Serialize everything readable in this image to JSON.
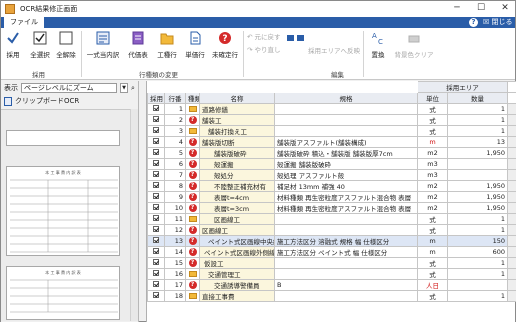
{
  "window": {
    "title": "OCR結果修正画面",
    "close_label": "✕",
    "close_panel_label": "閉じる"
  },
  "menu": {
    "file_tab": "ファイル",
    "help": "?"
  },
  "ribbon": {
    "adopt": "採用",
    "select_all": "全選択",
    "deselect_all": "全解除",
    "group_adopt": "採用",
    "batch_match": "一式当内訳",
    "replace": "代価表",
    "work_rows": "工種行",
    "unit_rows": "単価行",
    "unconfirmed": "未確定行",
    "group_row_kind": "行種類の変更",
    "undo": "元に戻す",
    "redo": "やり直し",
    "adopt_area_move": "採用エリアへ反映",
    "group_edit": "編集",
    "replace_text": "置換",
    "clear_bg": "背景色クリア"
  },
  "left": {
    "display_label": "表示",
    "zoom_value": "ページレベルにズーム",
    "clipboard_ocr": "クリップボードOCR",
    "page_title": "本 工 事 費 内 訳 表"
  },
  "grid": {
    "adopt_area_title": "採用エリア",
    "headers": [
      "採用",
      "行番",
      "種類",
      "名称",
      "規格",
      "単位",
      "数量"
    ],
    "rows": [
      {
        "no": "1",
        "kind": "folder",
        "name": "道路修繕",
        "spec": "",
        "unit": "式",
        "qty": "1"
      },
      {
        "no": "2",
        "kind": "q",
        "name": "舗装工",
        "spec": "",
        "unit": "式",
        "qty": "1"
      },
      {
        "no": "3",
        "kind": "folder",
        "name": "舗装打換え工",
        "spec": "",
        "unit": "式",
        "qty": "1"
      },
      {
        "no": "4",
        "kind": "q",
        "name": "舗装版切断",
        "spec": "舗装版アスファルト(舗装構成)",
        "unit": "m",
        "qty": "13",
        "unit_red": true
      },
      {
        "no": "5",
        "kind": "q",
        "name": "舗装版破砕",
        "spec": "舗装版破砕 積込・舗装版 舗装版厚7cm",
        "unit": "m2",
        "qty": "1,950"
      },
      {
        "no": "6",
        "kind": "q",
        "name": "殻運搬",
        "spec": "殻運搬 舗装版破砕",
        "unit": "m3",
        "qty": ""
      },
      {
        "no": "7",
        "kind": "q",
        "name": "殻処分",
        "spec": "殻処理 アスファルト殻",
        "unit": "m3",
        "qty": ""
      },
      {
        "no": "8",
        "kind": "q",
        "name": "不陸整正補充材有",
        "spec": "補足材 13mm 補強 40",
        "unit": "m2",
        "qty": "1,950"
      },
      {
        "no": "9",
        "kind": "q",
        "name": "表層t=4cm",
        "spec": "材料種類 再生密粒度アスファルト混合物 表層",
        "unit": "m2",
        "qty": "1,950"
      },
      {
        "no": "10",
        "kind": "q",
        "name": "表層t=3cm",
        "spec": "材料種類 再生密粒度アスファルト混合物 表層",
        "unit": "m2",
        "qty": "1,950"
      },
      {
        "no": "11",
        "kind": "folder",
        "name": "区画線工",
        "spec": "",
        "unit": "式",
        "qty": "1"
      },
      {
        "no": "12",
        "kind": "q",
        "name": "区画線工",
        "spec": "",
        "unit": "式",
        "qty": "1"
      },
      {
        "no": "13",
        "kind": "q",
        "name": "ペイント式区画線中央線",
        "spec": "施工方法区分 溶融式 規格 幅 仕様区分",
        "unit": "m",
        "qty": "150",
        "sel": true
      },
      {
        "no": "14",
        "kind": "q",
        "name": "ペイント式区画線外側線",
        "spec": "施工方法区分 ペイント式 幅 仕様区分",
        "unit": "m",
        "qty": "600"
      },
      {
        "no": "15",
        "kind": "q",
        "name": "仮設工",
        "spec": "",
        "unit": "式",
        "qty": "1"
      },
      {
        "no": "16",
        "kind": "folder",
        "name": "交通管理工",
        "spec": "",
        "unit": "式",
        "qty": "1"
      },
      {
        "no": "17",
        "kind": "q",
        "name": "交通誘導警備員",
        "spec": "B",
        "unit": "人日",
        "qty": "",
        "unit_red": true
      },
      {
        "no": "18",
        "kind": "folder",
        "name": "直接工事費",
        "spec": "",
        "unit": "式",
        "qty": "1"
      }
    ]
  }
}
